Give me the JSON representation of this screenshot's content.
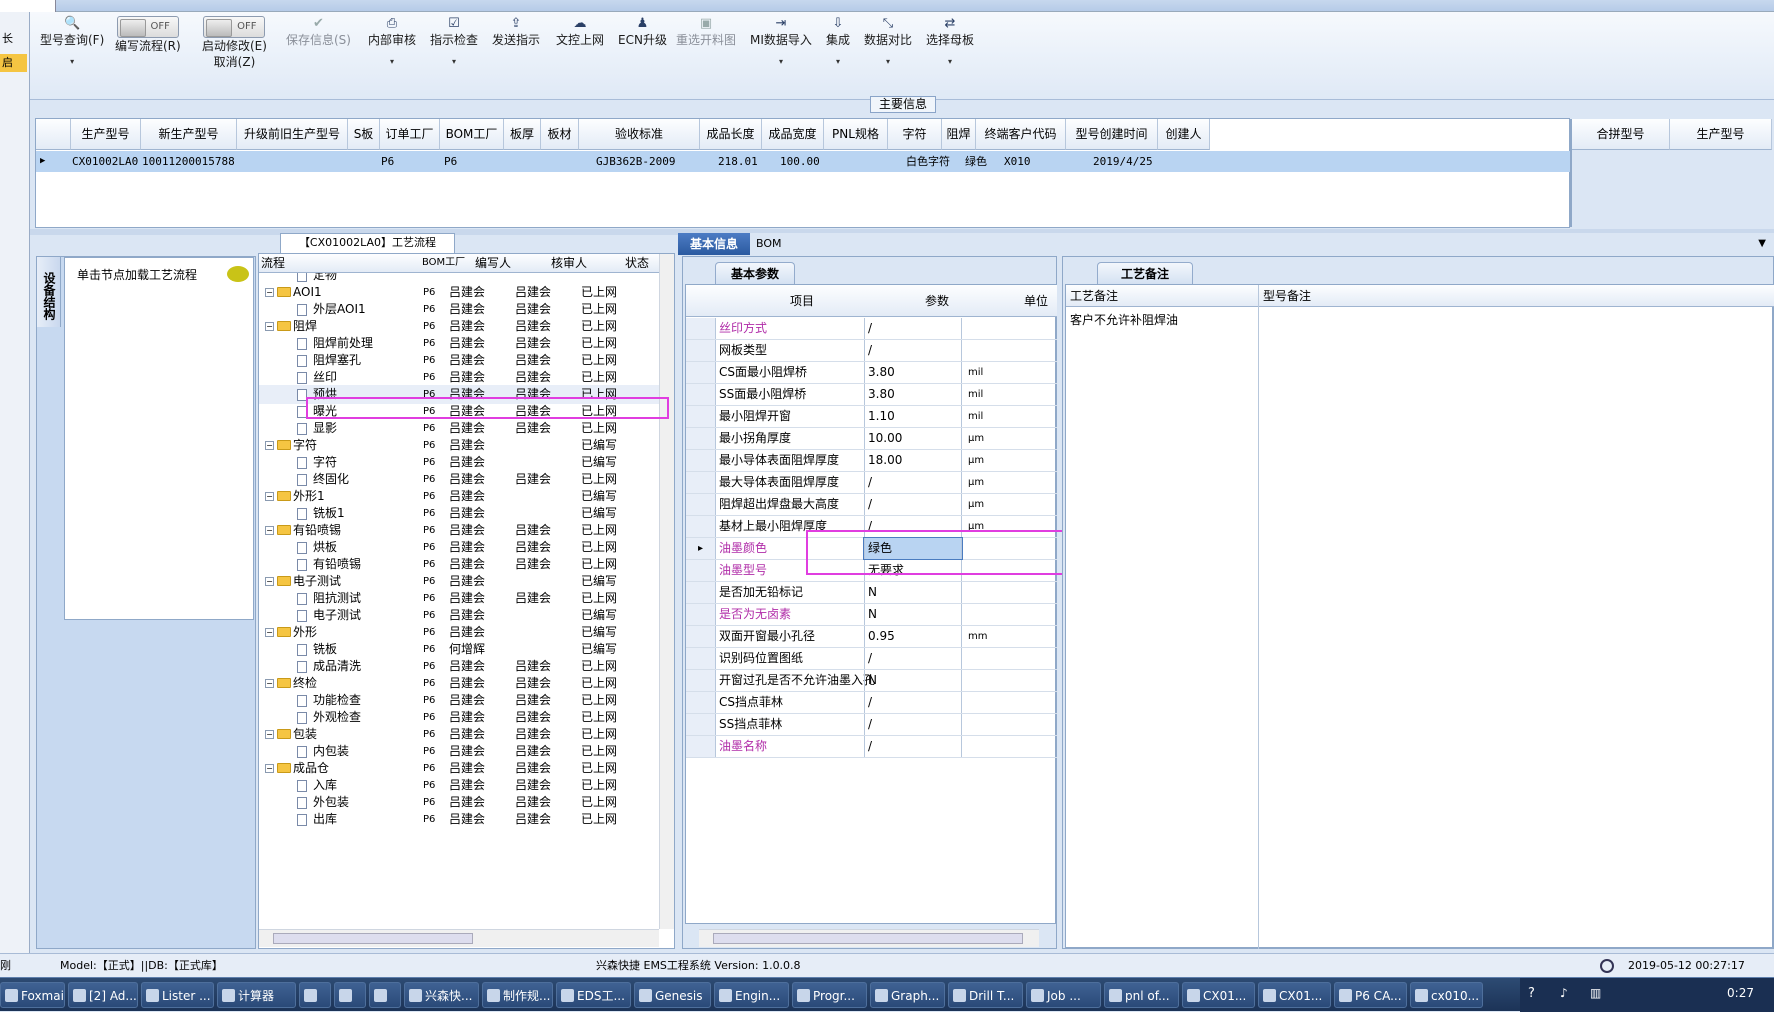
{
  "left_strip": {
    "items": [
      "长",
      "启"
    ]
  },
  "toolbar": {
    "buttons": [
      {
        "label": "型号查询(F)",
        "icon": "search-icon"
      },
      {
        "label": "编写流程(R)",
        "toggle": "OFF"
      },
      {
        "label": "启动修改(E)",
        "sub": "取消(Z)",
        "toggle": "OFF"
      },
      {
        "label": "保存信息(S)",
        "icon": "check-icon",
        "disabled": true
      },
      {
        "label": "内部审核",
        "icon": "printer-icon"
      },
      {
        "label": "指示检查",
        "icon": "check-icon"
      },
      {
        "label": "发送指示",
        "icon": "upload-icon"
      },
      {
        "label": "文控上网",
        "icon": "cloud-icon"
      },
      {
        "label": "ECN升级",
        "icon": "user-icon"
      },
      {
        "label": "重选开料图",
        "icon": "image-icon",
        "disabled": true
      },
      {
        "label": "MI数据导入",
        "icon": "import-icon"
      },
      {
        "label": "集成",
        "icon": "download-icon"
      },
      {
        "label": "数据对比",
        "icon": "compare-icon"
      },
      {
        "label": "选择母板",
        "icon": "shuffle-icon"
      }
    ],
    "group_label": "主要信息"
  },
  "main_grid": {
    "headers": [
      "生产型号",
      "新生产型号",
      "升级前旧生产型号",
      "S板",
      "订单工厂",
      "BOM工厂",
      "板厚",
      "板材",
      "验收标准",
      "成品长度",
      "成品宽度",
      "PNL规格",
      "字符",
      "阻焊",
      "终端客户代码",
      "型号创建时间",
      "创建人"
    ],
    "row": [
      "CX01002LA0",
      "10011200015788",
      "",
      "",
      "P6",
      "P6",
      "",
      "",
      "GJB362B-2009",
      "218.01",
      "100.00",
      "",
      "白色字符",
      "绿色",
      "X010",
      "2019/4/25",
      ""
    ],
    "side_headers": [
      "合拼型号",
      "生产型号"
    ]
  },
  "left_panel": {
    "vertical_tab": "设备结构",
    "button": "单击节点加载工艺流程"
  },
  "flow_panel": {
    "title": "【CX01002LA0】工艺流程",
    "headers": [
      "流程",
      "BOM工厂",
      "编写人",
      "核审人",
      "状态"
    ],
    "rows": [
      {
        "n": "定物",
        "t": "doc",
        "lv": 2,
        "b": "",
        "w": "",
        "c": "",
        "s": ""
      },
      {
        "n": "AOI1",
        "t": "folder",
        "lv": 1,
        "b": "P6",
        "w": "吕建会",
        "c": "吕建会",
        "s": "已上网"
      },
      {
        "n": "外层AOI1",
        "t": "doc",
        "lv": 2,
        "b": "P6",
        "w": "吕建会",
        "c": "吕建会",
        "s": "已上网"
      },
      {
        "n": "阻焊",
        "t": "folder",
        "lv": 1,
        "b": "P6",
        "w": "吕建会",
        "c": "吕建会",
        "s": "已上网"
      },
      {
        "n": "阻焊前处理",
        "t": "doc",
        "lv": 2,
        "b": "P6",
        "w": "吕建会",
        "c": "吕建会",
        "s": "已上网"
      },
      {
        "n": "阻焊塞孔",
        "t": "doc",
        "lv": 2,
        "b": "P6",
        "w": "吕建会",
        "c": "吕建会",
        "s": "已上网"
      },
      {
        "n": "丝印",
        "t": "doc",
        "lv": 2,
        "b": "P6",
        "w": "吕建会",
        "c": "吕建会",
        "s": "已上网"
      },
      {
        "n": "预烘",
        "t": "doc",
        "lv": 2,
        "b": "P6",
        "w": "吕建会",
        "c": "吕建会",
        "s": "已上网"
      },
      {
        "n": "曝光",
        "t": "doc",
        "lv": 2,
        "b": "P6",
        "w": "吕建会",
        "c": "吕建会",
        "s": "已上网"
      },
      {
        "n": "显影",
        "t": "doc",
        "lv": 2,
        "b": "P6",
        "w": "吕建会",
        "c": "吕建会",
        "s": "已上网"
      },
      {
        "n": "字符",
        "t": "folder",
        "lv": 1,
        "b": "P6",
        "w": "吕建会",
        "c": "",
        "s": "已编写"
      },
      {
        "n": "字符",
        "t": "doc",
        "lv": 2,
        "b": "P6",
        "w": "吕建会",
        "c": "",
        "s": "已编写"
      },
      {
        "n": "终固化",
        "t": "doc",
        "lv": 2,
        "b": "P6",
        "w": "吕建会",
        "c": "吕建会",
        "s": "已上网"
      },
      {
        "n": "外形1",
        "t": "folder",
        "lv": 1,
        "b": "P6",
        "w": "吕建会",
        "c": "",
        "s": "已编写"
      },
      {
        "n": "铣板1",
        "t": "doc",
        "lv": 2,
        "b": "P6",
        "w": "吕建会",
        "c": "",
        "s": "已编写"
      },
      {
        "n": "有铅喷锡",
        "t": "folder",
        "lv": 1,
        "b": "P6",
        "w": "吕建会",
        "c": "吕建会",
        "s": "已上网"
      },
      {
        "n": "烘板",
        "t": "doc",
        "lv": 2,
        "b": "P6",
        "w": "吕建会",
        "c": "吕建会",
        "s": "已上网"
      },
      {
        "n": "有铅喷锡",
        "t": "doc",
        "lv": 2,
        "b": "P6",
        "w": "吕建会",
        "c": "吕建会",
        "s": "已上网"
      },
      {
        "n": "电子测试",
        "t": "folder",
        "lv": 1,
        "b": "P6",
        "w": "吕建会",
        "c": "",
        "s": "已编写"
      },
      {
        "n": "阻抗测试",
        "t": "doc",
        "lv": 2,
        "b": "P6",
        "w": "吕建会",
        "c": "吕建会",
        "s": "已上网"
      },
      {
        "n": "电子测试",
        "t": "doc",
        "lv": 2,
        "b": "P6",
        "w": "吕建会",
        "c": "",
        "s": "已编写"
      },
      {
        "n": "外形",
        "t": "folder",
        "lv": 1,
        "b": "P6",
        "w": "吕建会",
        "c": "",
        "s": "已编写"
      },
      {
        "n": "铣板",
        "t": "doc",
        "lv": 2,
        "b": "P6",
        "w": "何增辉",
        "c": "",
        "s": "已编写"
      },
      {
        "n": "成品清洗",
        "t": "doc",
        "lv": 2,
        "b": "P6",
        "w": "吕建会",
        "c": "吕建会",
        "s": "已上网"
      },
      {
        "n": "终检",
        "t": "folder",
        "lv": 1,
        "b": "P6",
        "w": "吕建会",
        "c": "吕建会",
        "s": "已上网"
      },
      {
        "n": "功能检查",
        "t": "doc",
        "lv": 2,
        "b": "P6",
        "w": "吕建会",
        "c": "吕建会",
        "s": "已上网"
      },
      {
        "n": "外观检查",
        "t": "doc",
        "lv": 2,
        "b": "P6",
        "w": "吕建会",
        "c": "吕建会",
        "s": "已上网"
      },
      {
        "n": "包装",
        "t": "folder",
        "lv": 1,
        "b": "P6",
        "w": "吕建会",
        "c": "吕建会",
        "s": "已上网"
      },
      {
        "n": "内包装",
        "t": "doc",
        "lv": 2,
        "b": "P6",
        "w": "吕建会",
        "c": "吕建会",
        "s": "已上网"
      },
      {
        "n": "成品仓",
        "t": "folder",
        "lv": 1,
        "b": "P6",
        "w": "吕建会",
        "c": "吕建会",
        "s": "已上网"
      },
      {
        "n": "入库",
        "t": "doc",
        "lv": 2,
        "b": "P6",
        "w": "吕建会",
        "c": "吕建会",
        "s": "已上网"
      },
      {
        "n": "外包装",
        "t": "doc",
        "lv": 2,
        "b": "P6",
        "w": "吕建会",
        "c": "吕建会",
        "s": "已上网"
      },
      {
        "n": "出库",
        "t": "doc",
        "lv": 2,
        "b": "P6",
        "w": "吕建会",
        "c": "吕建会",
        "s": "已上网"
      }
    ]
  },
  "info_panel": {
    "tabs": [
      "基本信息",
      "BOM"
    ],
    "sub_tab": "基本参数",
    "headers": [
      "项目",
      "参数",
      "单位"
    ],
    "rows": [
      {
        "item": "丝印方式",
        "val": "/",
        "unit": "",
        "hl": true
      },
      {
        "item": "网板类型",
        "val": "/",
        "unit": ""
      },
      {
        "item": "CS面最小阻焊桥",
        "val": "3.80",
        "unit": "mil"
      },
      {
        "item": "SS面最小阻焊桥",
        "val": "3.80",
        "unit": "mil"
      },
      {
        "item": "最小阻焊开窗",
        "val": "1.10",
        "unit": "mil"
      },
      {
        "item": "最小拐角厚度",
        "val": "10.00",
        "unit": "μm"
      },
      {
        "item": "最小导体表面阻焊厚度",
        "val": "18.00",
        "unit": "μm"
      },
      {
        "item": "最大导体表面阻焊厚度",
        "val": "/",
        "unit": "μm"
      },
      {
        "item": "阻焊超出焊盘最大高度",
        "val": "/",
        "unit": "μm"
      },
      {
        "item": "基材上最小阻焊厚度",
        "val": "/",
        "unit": "μm"
      },
      {
        "item": "油墨颜色",
        "val": "绿色",
        "unit": "",
        "hl": true,
        "current": true
      },
      {
        "item": "油墨型号",
        "val": "无要求",
        "unit": "",
        "hl": true
      },
      {
        "item": "是否加无铅标记",
        "val": "N",
        "unit": ""
      },
      {
        "item": "是否为无卤素",
        "val": "N",
        "unit": "",
        "hl": true
      },
      {
        "item": "双面开窗最小孔径",
        "val": "0.95",
        "unit": "mm"
      },
      {
        "item": "识别码位置图纸",
        "val": "/",
        "unit": ""
      },
      {
        "item": "开窗过孔是否不允许油墨入孔",
        "val": "N",
        "unit": ""
      },
      {
        "item": "CS挡点菲林",
        "val": "/",
        "unit": ""
      },
      {
        "item": "SS挡点菲林",
        "val": "/",
        "unit": ""
      },
      {
        "item": "油墨名称",
        "val": "/",
        "unit": "",
        "hl": true
      }
    ]
  },
  "remark_panel": {
    "tab": "工艺备注",
    "headers": [
      "工艺备注",
      "型号备注"
    ],
    "value": "客户不允许补阻焊油"
  },
  "status_bar": {
    "left": "刚",
    "model": "Model:【正式】||DB:【正式库】",
    "center": "兴森快捷 EMS工程系统 Version: 1.0.0.8",
    "datetime": "2019-05-12 00:27:17"
  },
  "taskbar": {
    "items": [
      "Foxmail",
      "[2] Ad...",
      "Lister ...",
      "计算器",
      "",
      "",
      "",
      "兴森快...",
      "制作规...",
      "EDS工...",
      "Genesis",
      "Engin...",
      "Progr...",
      "Graph...",
      "Drill T...",
      "Job ...",
      "pnl of...",
      "CX01...",
      "CX01...",
      "P6 CA...",
      "cx010..."
    ],
    "clock": "0:27"
  },
  "colors": {
    "accent": "#b02ca8",
    "highlight_box": "#e03de0",
    "selection": "#b9d4f2",
    "panel_bg": "#dbe6f4"
  }
}
